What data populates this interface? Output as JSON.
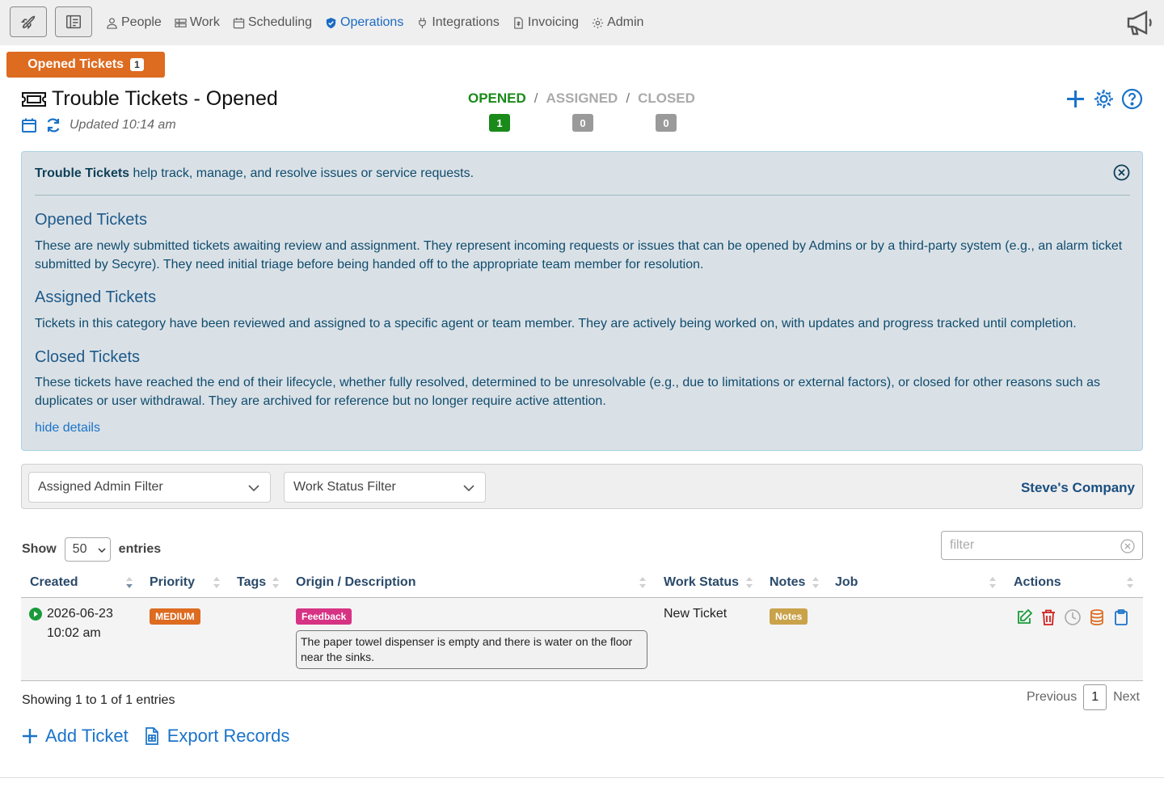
{
  "nav": {
    "items": [
      {
        "label": "People",
        "icon": "person-icon"
      },
      {
        "label": "Work",
        "icon": "grid-icon"
      },
      {
        "label": "Scheduling",
        "icon": "calendar-icon"
      },
      {
        "label": "Operations",
        "icon": "shield-check-icon",
        "active": true
      },
      {
        "label": "Integrations",
        "icon": "plug-icon"
      },
      {
        "label": "Invoicing",
        "icon": "invoice-icon"
      },
      {
        "label": "Admin",
        "icon": "gear-icon"
      }
    ]
  },
  "tab": {
    "label": "Opened Tickets",
    "count": "1"
  },
  "header": {
    "title": "Trouble Tickets - Opened",
    "updated": "Updated 10:14 am",
    "status_opened": "OPENED",
    "status_assigned": "ASSIGNED",
    "status_closed": "CLOSED",
    "sep": "/",
    "count_opened": "1",
    "count_assigned": "0",
    "count_closed": "0"
  },
  "info": {
    "intro_bold": "Trouble Tickets",
    "intro_rest": " help track, manage, and resolve issues or service requests.",
    "opened_heading": "Opened Tickets",
    "opened_text": "These are newly submitted tickets awaiting review and assignment. They represent incoming requests or issues that can be opened by Admins or by a third-party system (e.g., an alarm ticket submitted by Secyre). They need initial triage before being handed off to the appropriate team member for resolution.",
    "assigned_heading": "Assigned Tickets",
    "assigned_text": "Tickets in this category have been reviewed and assigned to a specific agent or team member. They are actively being worked on, with updates and progress tracked until completion.",
    "closed_heading": "Closed Tickets",
    "closed_text": "These tickets have reached the end of their lifecycle, whether fully resolved, determined to be unresolvable (e.g., due to limitations or external factors), or closed for other reasons such as duplicates or user withdrawal. They are archived for reference but no longer require active attention.",
    "hide_details": "hide details"
  },
  "filters": {
    "admin_filter": "Assigned Admin Filter",
    "status_filter": "Work Status Filter",
    "company": "Steve's Company"
  },
  "table": {
    "show_label": "Show",
    "entries_value": "50",
    "entries_label": "entries",
    "filter_placeholder": "filter",
    "columns": [
      "Created",
      "Priority",
      "Tags",
      "Origin / Description",
      "Work Status",
      "Notes",
      "Job",
      "Actions"
    ],
    "rows": [
      {
        "date": "2026-06-23",
        "time": "10:02 am",
        "priority": "MEDIUM",
        "origin": "Feedback",
        "description": "The paper towel dispenser is empty and there is water on the floor near the sinks.",
        "work_status": "New Ticket",
        "notes": "Notes"
      }
    ],
    "showing": "Showing 1 to 1 of 1 entries",
    "previous": "Previous",
    "page": "1",
    "next": "Next"
  },
  "bottom": {
    "add_ticket": "Add Ticket",
    "export": "Export Records"
  },
  "colors": {
    "accent": "#1a73c9",
    "tab_orange": "#dd6b20",
    "opened_green": "#1a8a1a",
    "priority_medium": "#dd6b20",
    "feedback_pink": "#d63384",
    "notes_gold": "#c9a24a"
  }
}
